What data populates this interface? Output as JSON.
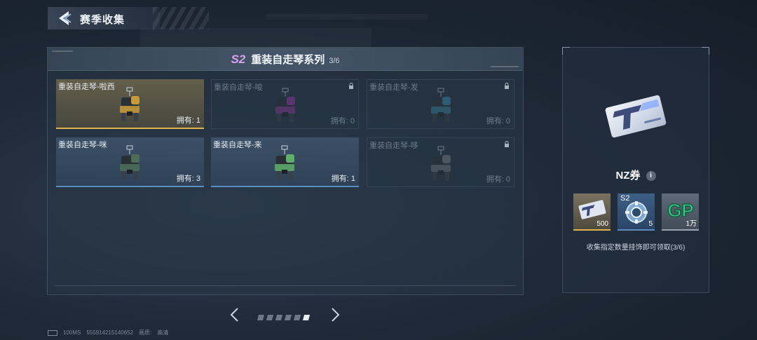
{
  "header": {
    "title": "赛季收集"
  },
  "panel": {
    "season_badge": "S2",
    "title": "重装自走琴系列",
    "progress": "3/6"
  },
  "cards": [
    {
      "name": "重装自走琴-啦西",
      "own_label": "拥有: 1",
      "state": "gold",
      "mech_color": "#c79a3a"
    },
    {
      "name": "重装自走琴-唆",
      "own_label": "拥有: 0",
      "state": "locked",
      "mech_color": "#9d3ba5"
    },
    {
      "name": "重装自走琴-发",
      "own_label": "拥有: 0",
      "state": "locked",
      "mech_color": "#3e8fa8"
    },
    {
      "name": "重装自走琴-咪",
      "own_label": "拥有: 3",
      "state": "owned",
      "mech_color": "#4e6d58"
    },
    {
      "name": "重装自走琴-来",
      "own_label": "拥有: 1",
      "state": "owned",
      "mech_color": "#5fae6a"
    },
    {
      "name": "重装自走琴-哆",
      "own_label": "拥有: 0",
      "state": "locked",
      "mech_color": "#7a8088"
    }
  ],
  "pagination": {
    "total": 6,
    "active": 6
  },
  "reward": {
    "name": "NZ券",
    "info_label": "i",
    "items": [
      {
        "qty": "500",
        "icon": "nz-ticket-icon",
        "border": "#e3b24d"
      },
      {
        "qty": "5",
        "tag": "S2",
        "icon": "s2-core-icon",
        "border": "#5b8cc4"
      },
      {
        "qty": "1万",
        "icon": "gp-icon",
        "border": "#9aa5b2"
      }
    ],
    "description": "收集指定数量挂饰即可领取(3/6)"
  },
  "status": {
    "ping": "100MS",
    "id": "555914215140652",
    "quality_label": "画质:",
    "quality_value": "高清"
  }
}
